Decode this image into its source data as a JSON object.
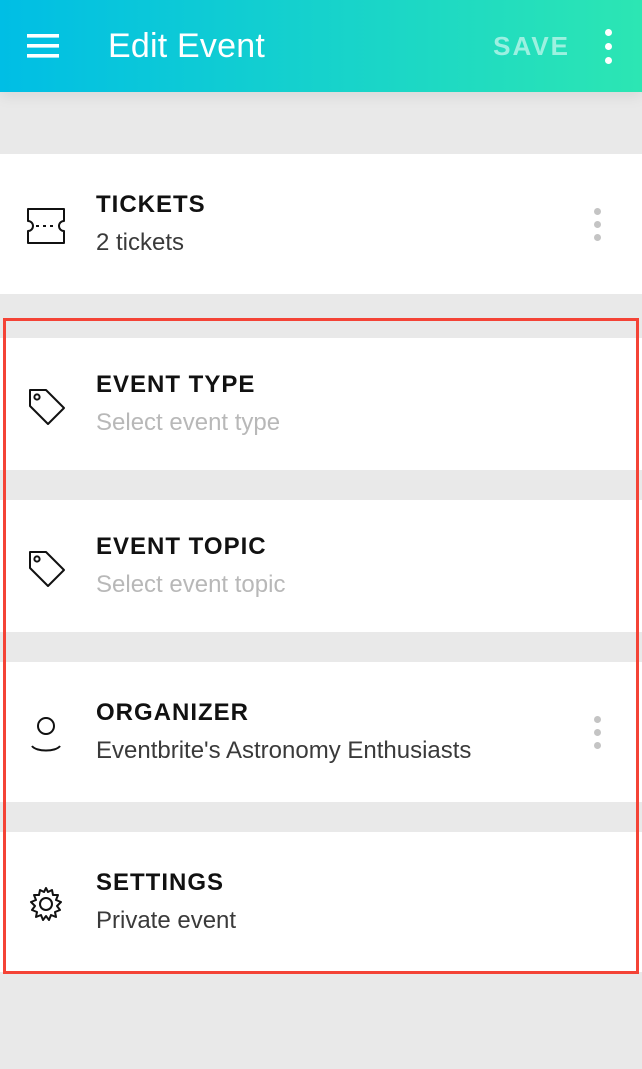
{
  "header": {
    "title": "Edit Event",
    "save_label": "SAVE"
  },
  "sections": {
    "tickets": {
      "title": "TICKETS",
      "subtitle": "2 tickets"
    },
    "event_type": {
      "title": "EVENT TYPE",
      "placeholder": "Select event type"
    },
    "event_topic": {
      "title": "EVENT TOPIC",
      "placeholder": "Select event topic"
    },
    "organizer": {
      "title": "ORGANIZER",
      "subtitle": "Eventbrite's Astronomy Enthusiasts"
    },
    "settings": {
      "title": "SETTINGS",
      "subtitle": "Private event"
    }
  }
}
